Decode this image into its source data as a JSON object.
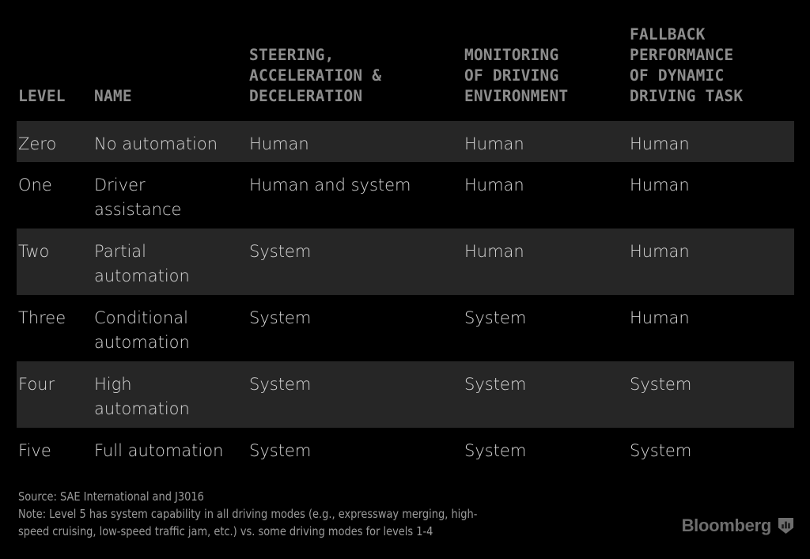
{
  "table": {
    "headers": [
      {
        "key": "level",
        "label": "LEVEL"
      },
      {
        "key": "name",
        "label": "NAME"
      },
      {
        "key": "steering",
        "label": "STEERING,\nACCELERATION &\nDECELERATION"
      },
      {
        "key": "monitoring",
        "label": "MONITORING\nOF DRIVING\nENVIRONMENT"
      },
      {
        "key": "fallback",
        "label": "FALLBACK\nPERFORMANCE\nOF DYNAMIC\nDRIVING TASK"
      }
    ],
    "rows": [
      {
        "level": "Zero",
        "name": "No automation",
        "steering": "Human",
        "monitoring": "Human",
        "fallback": "Human"
      },
      {
        "level": "One",
        "name": "Driver\nassistance",
        "steering": "Human and system",
        "monitoring": "Human",
        "fallback": "Human"
      },
      {
        "level": "Two",
        "name": "Partial\nautomation",
        "steering": "System",
        "monitoring": "Human",
        "fallback": "Human"
      },
      {
        "level": "Three",
        "name": "Conditional\nautomation",
        "steering": "System",
        "monitoring": "System",
        "fallback": "Human"
      },
      {
        "level": "Four",
        "name": "High\nautomation",
        "steering": "System",
        "monitoring": "System",
        "fallback": "System"
      },
      {
        "level": "Five",
        "name": "Full automation",
        "steering": "System",
        "monitoring": "System",
        "fallback": "System"
      }
    ]
  },
  "footnotes": {
    "source": "Source: SAE International and J3016",
    "note": "Note: Level 5 has system capability in all driving modes (e.g., expressway merging, high-\nspeed cruising, low-speed traffic jam, etc.) vs. some driving modes for levels 1-4"
  },
  "brand": {
    "name": "Bloomberg",
    "mark_icon": "bloomberg-shield-bars-icon"
  },
  "colors": {
    "background": "#000000",
    "stripe": "#262626",
    "header_text": "#8c8c8c",
    "body_text": "#d6d6d6",
    "footnote_text": "#9a9a9a",
    "brand_text": "#6e6e6e"
  }
}
